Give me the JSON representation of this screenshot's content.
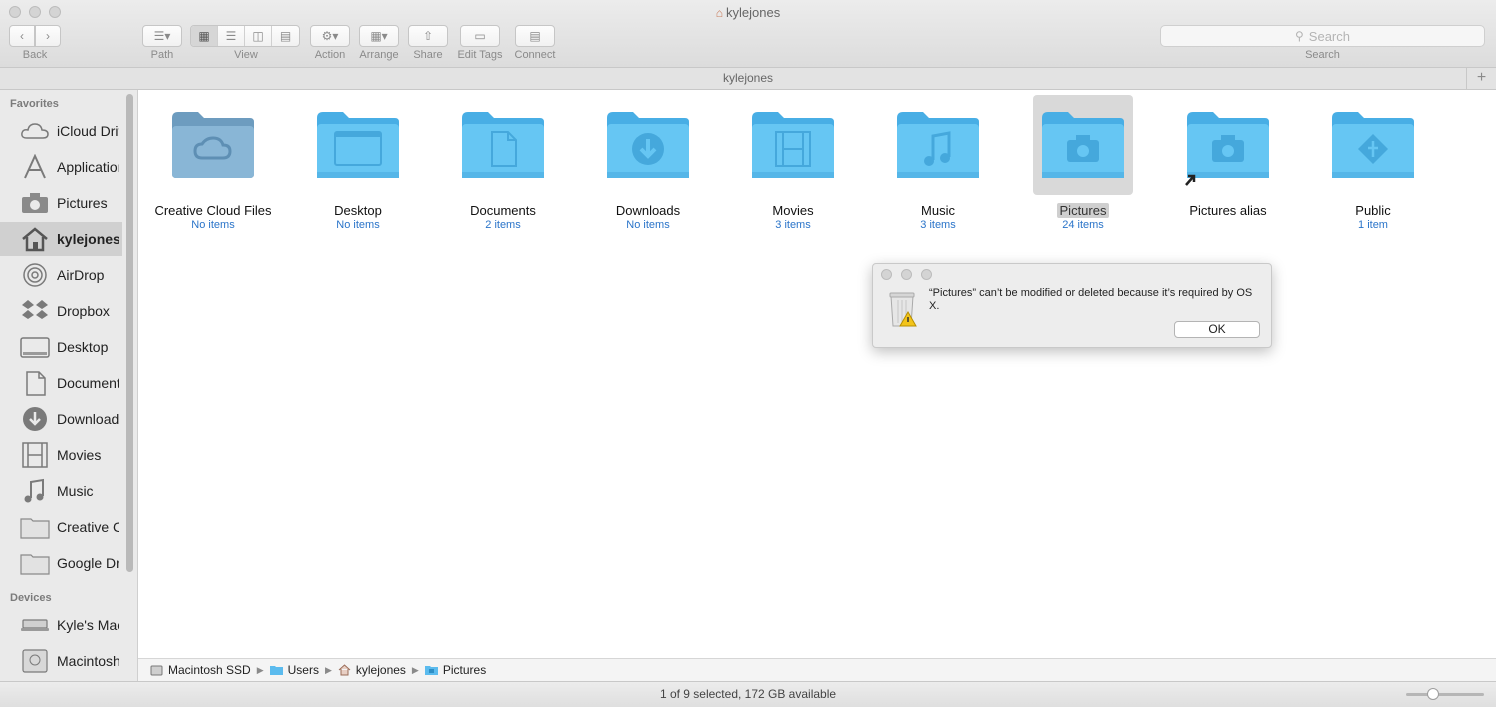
{
  "window": {
    "title": "kylejones",
    "path_title": "kylejones"
  },
  "toolbar": {
    "back_label": "Back",
    "path_label": "Path",
    "view_label": "View",
    "action_label": "Action",
    "arrange_label": "Arrange",
    "share_label": "Share",
    "edit_tags_label": "Edit Tags",
    "connect_label": "Connect",
    "search_placeholder": "Search",
    "search_label": "Search"
  },
  "sidebar": {
    "favorites_header": "Favorites",
    "devices_header": "Devices",
    "favorites": [
      {
        "label": "iCloud Drive",
        "icon": "cloud-icon"
      },
      {
        "label": "Applications",
        "icon": "applications-icon"
      },
      {
        "label": "Pictures",
        "icon": "camera-icon"
      },
      {
        "label": "kylejones",
        "icon": "home-icon",
        "selected": true
      },
      {
        "label": "AirDrop",
        "icon": "airdrop-icon"
      },
      {
        "label": "Dropbox",
        "icon": "dropbox-icon"
      },
      {
        "label": "Desktop",
        "icon": "desktop-icon"
      },
      {
        "label": "Documents",
        "icon": "document-icon"
      },
      {
        "label": "Downloads",
        "icon": "download-icon"
      },
      {
        "label": "Movies",
        "icon": "film-icon"
      },
      {
        "label": "Music",
        "icon": "music-icon"
      },
      {
        "label": "Creative Cloud Files",
        "icon": "folder-icon"
      },
      {
        "label": "Google Drive",
        "icon": "folder-icon"
      }
    ],
    "devices": [
      {
        "label": "Kyle's MacBook",
        "icon": "laptop-icon"
      },
      {
        "label": "Macintosh SSD",
        "icon": "disk-icon"
      }
    ]
  },
  "items": [
    {
      "name": "Creative Cloud Files",
      "count": "No items",
      "icon": "creative-cloud-folder-icon"
    },
    {
      "name": "Desktop",
      "count": "No items",
      "icon": "desktop-folder-icon"
    },
    {
      "name": "Documents",
      "count": "2 items",
      "icon": "documents-folder-icon"
    },
    {
      "name": "Downloads",
      "count": "No items",
      "icon": "downloads-folder-icon"
    },
    {
      "name": "Movies",
      "count": "3 items",
      "icon": "movies-folder-icon"
    },
    {
      "name": "Music",
      "count": "3 items",
      "icon": "music-folder-icon"
    },
    {
      "name": "Pictures",
      "count": "24 items",
      "icon": "pictures-folder-icon",
      "selected": true
    },
    {
      "name": "Pictures alias",
      "count": "",
      "icon": "pictures-alias-folder-icon"
    },
    {
      "name": "Public",
      "count": "1 item",
      "icon": "public-folder-icon"
    }
  ],
  "breadcrumb": [
    "Macintosh SSD",
    "Users",
    "kylejones",
    "Pictures"
  ],
  "status": "1 of 9 selected, 172 GB available",
  "dialog": {
    "message": "“Pictures” can’t be modified or deleted because it’s required by OS X.",
    "ok_label": "OK"
  },
  "colors": {
    "folder": "#5bc0f0",
    "link": "#2a74c9",
    "selection": "#d0d0d0"
  }
}
